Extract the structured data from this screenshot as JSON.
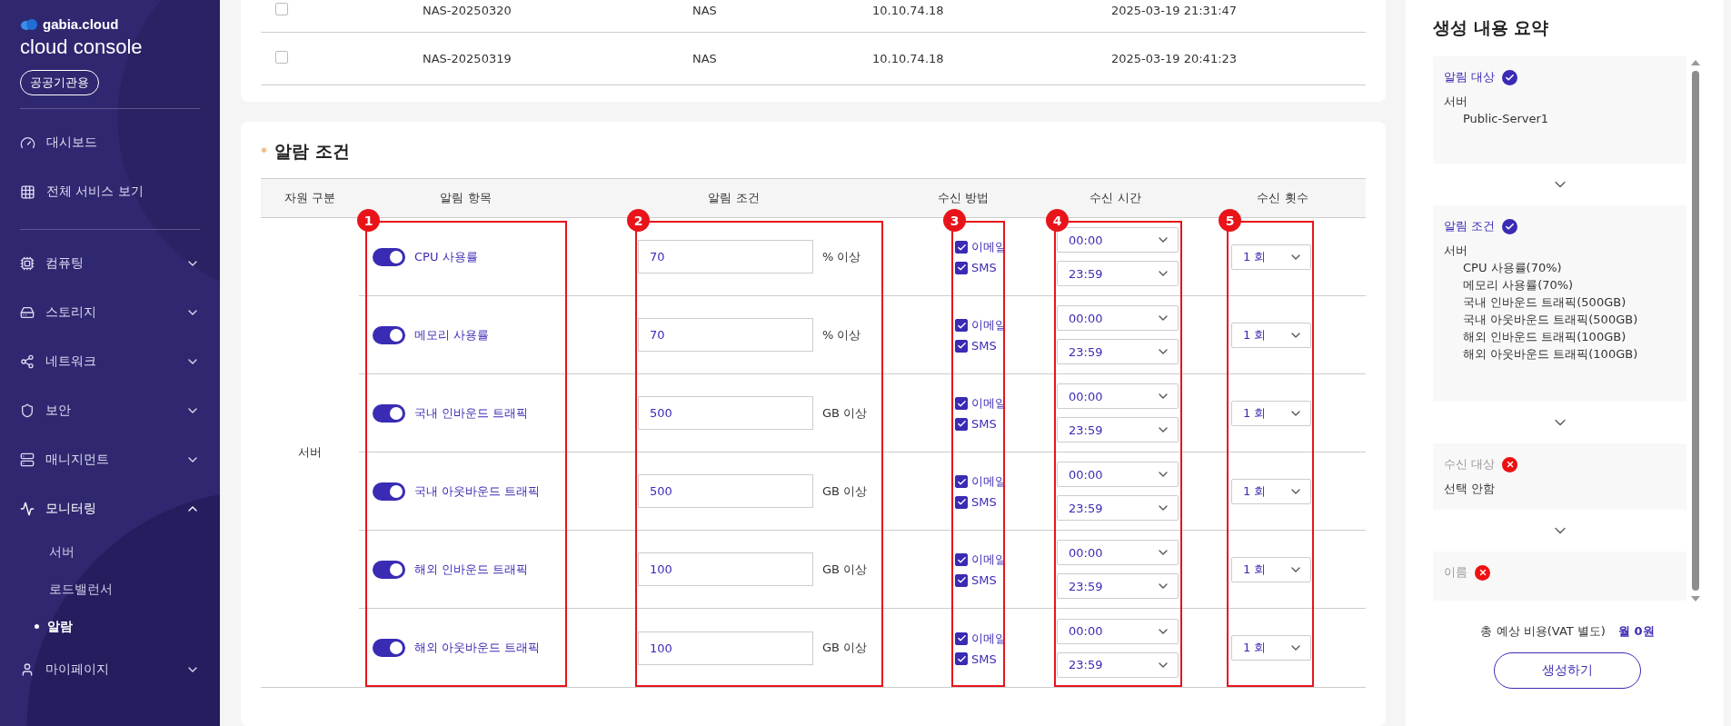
{
  "sidebar": {
    "logo": {
      "brand": "gabia.cloud",
      "product": "cloud console"
    },
    "badge": "공공기관용",
    "primary": [
      {
        "label": "대시보드"
      },
      {
        "label": "전체 서비스 보기"
      }
    ],
    "menu": [
      {
        "label": "컴퓨팅",
        "expanded": false
      },
      {
        "label": "스토리지",
        "expanded": false
      },
      {
        "label": "네트워크",
        "expanded": false
      },
      {
        "label": "보안",
        "expanded": false
      },
      {
        "label": "매니지먼트",
        "expanded": false
      },
      {
        "label": "모니터링",
        "expanded": true,
        "children": [
          {
            "label": "서버",
            "selected": false
          },
          {
            "label": "로드밸런서",
            "selected": false
          },
          {
            "label": "알람",
            "selected": true
          }
        ]
      },
      {
        "label": "마이페이지",
        "expanded": false
      }
    ]
  },
  "resource_table": {
    "rows": [
      {
        "checked": false,
        "cells": [
          "NAS-20250320",
          "NAS",
          "10.10.74.18",
          "2025-03-19 21:31:47"
        ]
      },
      {
        "checked": false,
        "cells": [
          "NAS-20250319",
          "NAS",
          "10.10.74.18",
          "2025-03-19 20:41:23"
        ]
      }
    ]
  },
  "alarm": {
    "required_mark": "*",
    "title": "알람 조건",
    "columns": [
      {
        "label": "자원 구분"
      },
      {
        "label": "알림 항목",
        "marker": "1"
      },
      {
        "label": "알림 조건",
        "marker": "2"
      },
      {
        "label": "수신 방법",
        "marker": "3"
      },
      {
        "label": "수신 시간",
        "marker": "4"
      },
      {
        "label": "수신 횟수",
        "marker": "5"
      }
    ],
    "resource": "서버",
    "rows": [
      {
        "item": "CPU 사용률",
        "on": true,
        "threshold": "70",
        "unit": "% 이상",
        "methods": [
          {
            "label": "이메일",
            "checked": true
          },
          {
            "label": "SMS",
            "checked": true
          }
        ],
        "start": "00:00",
        "end": "23:59",
        "count": "1 회"
      },
      {
        "item": "메모리 사용률",
        "on": true,
        "threshold": "70",
        "unit": "% 이상",
        "methods": [
          {
            "label": "이메일",
            "checked": true
          },
          {
            "label": "SMS",
            "checked": true
          }
        ],
        "start": "00:00",
        "end": "23:59",
        "count": "1 회"
      },
      {
        "item": "국내 인바운드 트래픽",
        "on": true,
        "threshold": "500",
        "unit": "GB 이상",
        "methods": [
          {
            "label": "이메일",
            "checked": true
          },
          {
            "label": "SMS",
            "checked": true
          }
        ],
        "start": "00:00",
        "end": "23:59",
        "count": "1 회"
      },
      {
        "item": "국내 아웃바운드 트래픽",
        "on": true,
        "threshold": "500",
        "unit": "GB 이상",
        "methods": [
          {
            "label": "이메일",
            "checked": true
          },
          {
            "label": "SMS",
            "checked": true
          }
        ],
        "start": "00:00",
        "end": "23:59",
        "count": "1 회"
      },
      {
        "item": "해외 인바운드 트래픽",
        "on": true,
        "threshold": "100",
        "unit": "GB 이상",
        "methods": [
          {
            "label": "이메일",
            "checked": true
          },
          {
            "label": "SMS",
            "checked": true
          }
        ],
        "start": "00:00",
        "end": "23:59",
        "count": "1 회"
      },
      {
        "item": "해외 아웃바운드 트래픽",
        "on": true,
        "threshold": "100",
        "unit": "GB 이상",
        "methods": [
          {
            "label": "이메일",
            "checked": true
          },
          {
            "label": "SMS",
            "checked": true
          }
        ],
        "start": "00:00",
        "end": "23:59",
        "count": "1 회"
      }
    ]
  },
  "summary": {
    "title": "생성 내용 요약",
    "sections": [
      {
        "title": "알림 대상",
        "complete": true,
        "group": "서버",
        "items": [
          "Public-Server1"
        ]
      },
      {
        "title": "알림 조건",
        "complete": true,
        "group": "서버",
        "items": [
          "CPU 사용률(70%)",
          "메모리 사용률(70%)",
          "국내 인바운드 트래픽(500GB)",
          "국내 아웃바운드 트래픽(500GB)",
          "해외 인바운드 트래픽(100GB)",
          "해외 아웃바운드 트래픽(100GB)"
        ]
      },
      {
        "title": "수신 대상",
        "complete": false,
        "note": "선택 안함"
      },
      {
        "title": "이름",
        "complete": false
      }
    ],
    "cost_label": "총 예상 비용(VAT 별도)",
    "cost_value": "월 **0**원",
    "create_button": "생성하기"
  }
}
